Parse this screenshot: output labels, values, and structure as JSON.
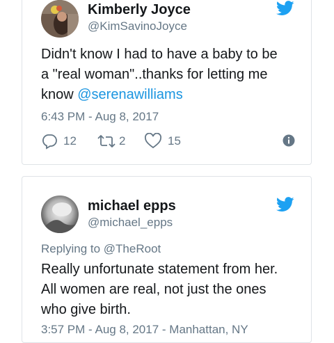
{
  "tweets": [
    {
      "name": "Kimberly Joyce",
      "handle": "@KimSavinoJoyce",
      "text_line1": "Didn't know I had to have a baby to be",
      "text_line2": "a \"real woman\"..thanks for letting me",
      "text_line3_prefix": "know ",
      "mention": "@serenawilliams",
      "timestamp": "6:43 PM - Aug 8, 2017",
      "replies": "12",
      "retweets": "2",
      "likes": "15"
    },
    {
      "name": "michael epps",
      "handle": "@michael_epps",
      "replying_prefix": "Replying to ",
      "replying_to": "@TheRoot",
      "text_line1": "Really unfortunate statement from her.",
      "text_line2": "All women are real, not just the ones",
      "text_line3": "who give birth.",
      "timestamp_partial": "3:57 PM - Aug 8, 2017 - Manhattan, NY"
    }
  ],
  "colors": {
    "twitter_blue": "#1da1f2",
    "link_blue": "#1b95e0",
    "secondary_text": "#657786",
    "border": "#dfe3e7"
  },
  "icons": [
    "twitter-bird-icon",
    "reply-icon",
    "retweet-icon",
    "like-heart-icon",
    "info-icon"
  ]
}
